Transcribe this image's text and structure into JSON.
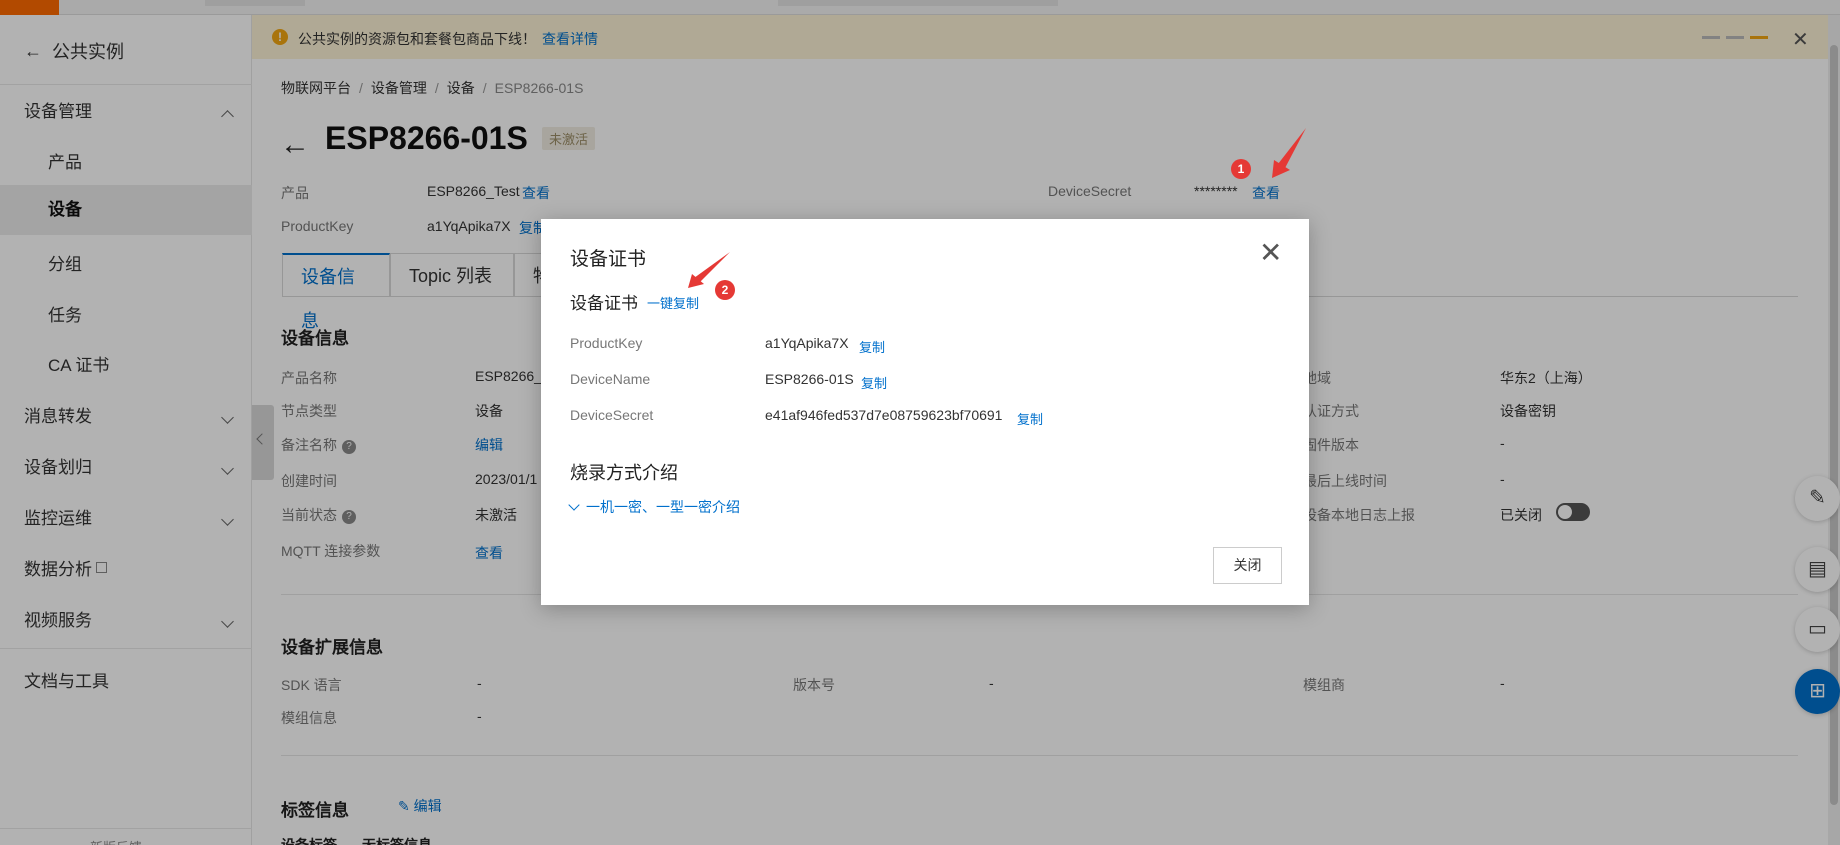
{
  "banner": {
    "message": "公共实例的资源包和套餐包商品下线！",
    "link": "查看详情",
    "close": "✕"
  },
  "sidebar": {
    "back_label": "公共实例",
    "items": [
      {
        "label": "设备管理"
      },
      {
        "label": "产品"
      },
      {
        "label": "设备"
      },
      {
        "label": "分组"
      },
      {
        "label": "任务"
      },
      {
        "label": "CA 证书"
      },
      {
        "label": "消息转发"
      },
      {
        "label": "设备划归"
      },
      {
        "label": "监控运维"
      },
      {
        "label": "数据分析"
      },
      {
        "label": "视频服务"
      },
      {
        "label": "文档与工具"
      }
    ],
    "feedback": "新版反馈"
  },
  "breadcrumb": {
    "items": [
      "物联网平台",
      "设备管理",
      "设备",
      "ESP8266-01S"
    ],
    "sep": "/"
  },
  "page": {
    "title": "ESP8266-01S",
    "status_tag": "未激活"
  },
  "summary": {
    "product_label": "产品",
    "product_value": "ESP8266_Test",
    "product_link": "查看",
    "productkey_label": "ProductKey",
    "productkey_value": "a1YqApika7X",
    "productkey_copy": "复制",
    "devicesecret_label": "DeviceSecret",
    "devicesecret_value": "********",
    "devicesecret_link": "查看"
  },
  "tabs": [
    {
      "label": "设备信息",
      "active": true
    },
    {
      "label": "Topic 列表",
      "active": false
    },
    {
      "label": "物",
      "active": false
    }
  ],
  "device_info": {
    "heading": "设备信息",
    "left": [
      {
        "label": "产品名称",
        "value": "ESP8266_T"
      },
      {
        "label": "节点类型",
        "value": "设备"
      },
      {
        "label": "备注名称",
        "value": "编辑",
        "help": "?"
      },
      {
        "label": "创建时间",
        "value": "2023/01/1"
      },
      {
        "label": "当前状态",
        "value": "未激活",
        "help": "?"
      },
      {
        "label": "MQTT 连接参数",
        "value": "查看"
      }
    ],
    "right": [
      {
        "label": "地域",
        "value": "华东2（上海）"
      },
      {
        "label": "认证方式",
        "value": "设备密钥"
      },
      {
        "label": "固件版本",
        "value": "-"
      },
      {
        "label": "最后上线时间",
        "value": "-"
      },
      {
        "label": "设备本地日志上报",
        "value": "已关闭"
      }
    ]
  },
  "ext_info": {
    "heading": "设备扩展信息",
    "rows": [
      {
        "label": "SDK 语言",
        "value": "-"
      },
      {
        "label": "版本号",
        "value": "-"
      },
      {
        "label": "模组商",
        "value": "-"
      },
      {
        "label": "模组信息",
        "value": "-"
      }
    ]
  },
  "tag_info": {
    "heading": "标签信息",
    "edit": "编辑",
    "col1": "设备标签",
    "col2": "无标签信息"
  },
  "modal": {
    "title": "设备证书",
    "section": "设备证书",
    "copy_all": "一键复制",
    "fields": [
      {
        "label": "ProductKey",
        "value": "a1YqApika7X",
        "copy": "复制"
      },
      {
        "label": "DeviceName",
        "value": "ESP8266-01S",
        "copy": "复制"
      },
      {
        "label": "DeviceSecret",
        "value": "e41af946fed537d7e08759623bf70691",
        "copy": "复制"
      }
    ],
    "burn_title": "烧录方式介绍",
    "burn_link": "一机一密、一型一密介绍",
    "close_button": "关闭"
  },
  "annotations": {
    "badge1": "1",
    "badge2": "2"
  },
  "colors": {
    "accent": "#0070cc",
    "brand": "#ff6a00",
    "banner_bg": "#fdf3d6",
    "badge": "#e53935"
  }
}
